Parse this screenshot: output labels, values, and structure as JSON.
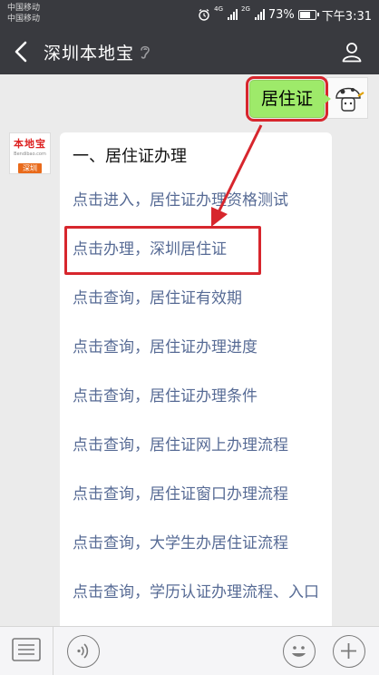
{
  "status_bar": {
    "carrier1": "中国移动",
    "carrier2": "中国移动",
    "net1": "4G",
    "net2": "2G",
    "battery_text": "73%",
    "battery_level": 0.73,
    "time": "下午3:31"
  },
  "header": {
    "title": "深圳本地宝"
  },
  "chat": {
    "user_message": "居住证",
    "account_avatar": {
      "brand": "本地宝",
      "url": "Bendibao.com",
      "tag": "深圳"
    },
    "reply": {
      "heading": "一、居住证办理",
      "links": [
        "点击进入，居住证办理资格测试",
        "点击办理，深圳居住证",
        "点击查询，居住证有效期",
        "点击查询，居住证办理进度",
        "点击查询，居住证办理条件",
        "点击查询，居住证网上办理流程",
        "点击查询，居住证窗口办理流程",
        "点击查询，大学生办居住证流程",
        "点击查询，学历认证办理流程、入口"
      ]
    }
  },
  "colors": {
    "title_bar": "#393a3f",
    "chat_bg": "#ebebeb",
    "user_bubble": "#9eea6a",
    "link": "#576b95",
    "highlight": "#d7262d"
  },
  "icons": {
    "back": "chevron-left-icon",
    "mute": "ear-mute-icon",
    "profile": "person-icon",
    "menu": "menu-list-icon",
    "voice": "voice-icon",
    "emoji": "emoji-icon",
    "more": "plus-icon"
  }
}
